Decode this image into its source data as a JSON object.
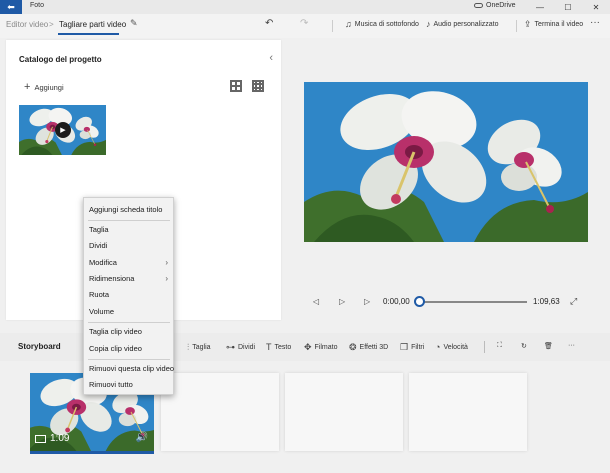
{
  "titlebar": {
    "back_glyph": "⬅",
    "app_name": "Foto",
    "onedrive": "OneDrive",
    "minimize": "—",
    "maximize": "☐",
    "close": "✕"
  },
  "toolbar": {
    "crumb_parent": "Editor video",
    "crumb_separator": ">",
    "crumb_current": "Tagliare parti video",
    "pencil_icon": "✎",
    "undo_icon": "↶",
    "redo_icon": "↷",
    "music_icon": "♫",
    "music_label": "Musica di sottofondo",
    "audio_icon": "♪",
    "audio_label": "Audio personalizzato",
    "finish_icon": "⇪",
    "finish_label": "Termina il video",
    "more_icon": "···"
  },
  "catalog": {
    "title": "Catalogo del progetto",
    "collapse_icon": "‹",
    "add_icon": "+",
    "add_label": "Aggiungi",
    "play_icon": "▶"
  },
  "playback": {
    "prev_icon": "◁",
    "play_icon": "▷",
    "next_icon": "▷",
    "current_time": "0:00,00",
    "total_time": "1:09,63",
    "expand_icon": "⤢",
    "position_fraction": 0
  },
  "storyboard": {
    "title": "Storyboard",
    "tools": [
      {
        "icon": "⫶",
        "label": "Taglia"
      },
      {
        "icon": "⊶",
        "label": "Dividi"
      },
      {
        "icon": "T",
        "label": "Testo"
      },
      {
        "icon": "✥",
        "label": "Filmato"
      },
      {
        "icon": "❂",
        "label": "Effetti 3D"
      },
      {
        "icon": "❒",
        "label": "Filtri"
      },
      {
        "icon": "◔",
        "label": "Velocità"
      }
    ],
    "fit_icon": "⛶",
    "rotate_icon": "↻",
    "delete_icon": "🗑",
    "more_icon": "···",
    "clip_duration": "1:09",
    "clip_speaker_icon": "🔊"
  },
  "context_menu": {
    "items": [
      {
        "label": "Aggiungi scheda titolo",
        "submenu": ""
      },
      {
        "label": "Taglia",
        "submenu": ""
      },
      {
        "label": "Dividi",
        "submenu": ""
      },
      {
        "label": "Modifica",
        "submenu": "›"
      },
      {
        "label": "Ridimensiona",
        "submenu": "›"
      },
      {
        "label": "Ruota",
        "submenu": ""
      },
      {
        "label": "Volume",
        "submenu": ""
      },
      {
        "label": "Taglia clip video",
        "submenu": ""
      },
      {
        "label": "Copia clip video",
        "submenu": ""
      },
      {
        "label": "Rimuovi questa clip video",
        "submenu": ""
      },
      {
        "label": "Rimuovi tutto",
        "submenu": ""
      }
    ]
  },
  "colors": {
    "accent": "#1f5aa6",
    "sky": "#2f86c7"
  }
}
